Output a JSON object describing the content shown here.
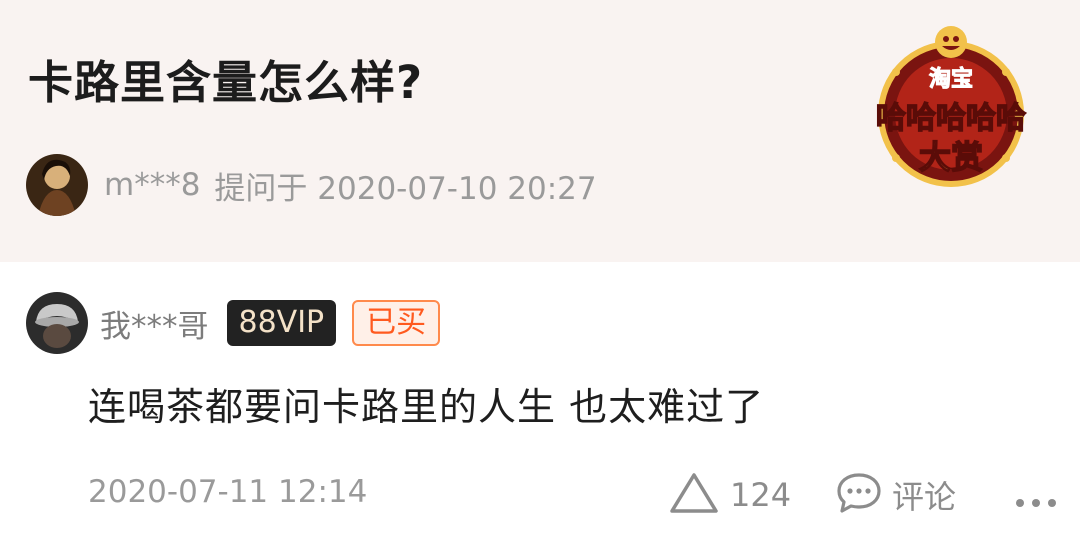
{
  "question": {
    "title": "卡路里含量怎么样?",
    "asker": {
      "name": "m***8",
      "meta": "提问于 2020-07-10 20:27",
      "avatar_icon": "user-photo-avatar"
    }
  },
  "logo": {
    "text_top": "淘宝",
    "text_middle": "哈哈哈哈哈",
    "text_bottom": "大赏",
    "colors": {
      "gold": "#f2c14a",
      "red": "#d52a1e",
      "dark": "#7a1410"
    }
  },
  "answer": {
    "author": {
      "name": "我***哥",
      "avatar_icon": "user-photo-avatar"
    },
    "vip_badge": "88VIP",
    "bought_badge": "已买",
    "text": "连喝茶都要问卡路里的人生 也太难过了",
    "date": "2020-07-11 12:14",
    "actions": {
      "like_count": "124",
      "like_icon": "triangle-up-icon",
      "comment_label": "评论",
      "comment_icon": "comment-bubble-icon",
      "more_icon": "more-dots-icon"
    }
  },
  "colors": {
    "header_bg": "#f9f3f1",
    "vip_bg": "#222222",
    "vip_text": "#f4e2c8",
    "bought_text": "#ff5a1f",
    "muted_text": "#9a9a9a"
  }
}
